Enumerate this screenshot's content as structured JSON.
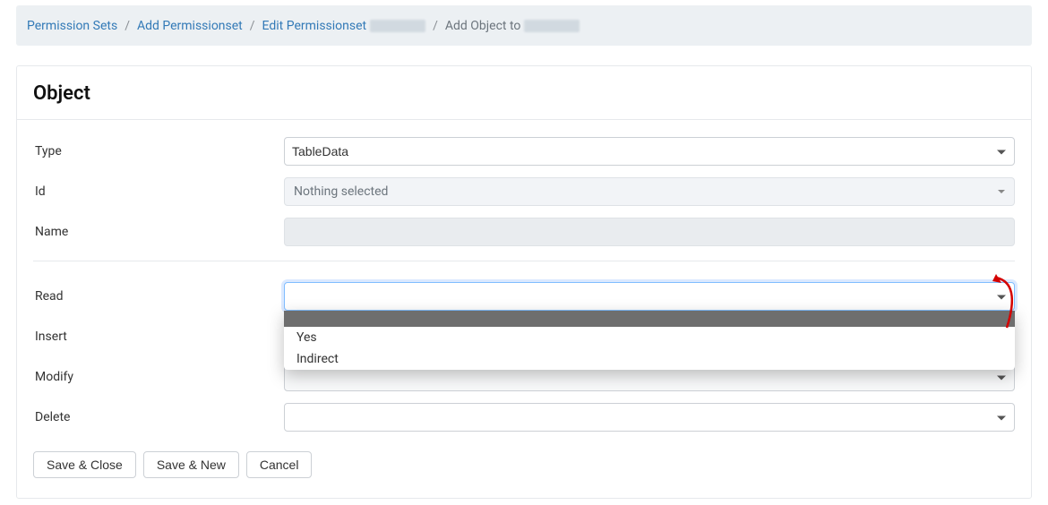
{
  "breadcrumb": {
    "items": [
      {
        "label": "Permission Sets",
        "link": true
      },
      {
        "label": "Add Permissionset",
        "link": true
      },
      {
        "label": "Edit Permissionset",
        "link": true,
        "masked_suffix": true
      },
      {
        "label": "Add Object to",
        "link": false,
        "masked_suffix": true
      }
    ]
  },
  "card": {
    "title": "Object"
  },
  "form": {
    "type": {
      "label": "Type",
      "value": "TableData"
    },
    "id": {
      "label": "Id",
      "placeholder": "Nothing selected"
    },
    "name": {
      "label": "Name",
      "value": ""
    },
    "read": {
      "label": "Read",
      "value": "",
      "options": [
        "",
        "Yes",
        "Indirect"
      ],
      "open": true
    },
    "insert": {
      "label": "Insert",
      "value": ""
    },
    "modify": {
      "label": "Modify",
      "value": ""
    },
    "delete": {
      "label": "Delete",
      "value": ""
    }
  },
  "buttons": {
    "save_close": "Save & Close",
    "save_new": "Save & New",
    "cancel": "Cancel"
  }
}
